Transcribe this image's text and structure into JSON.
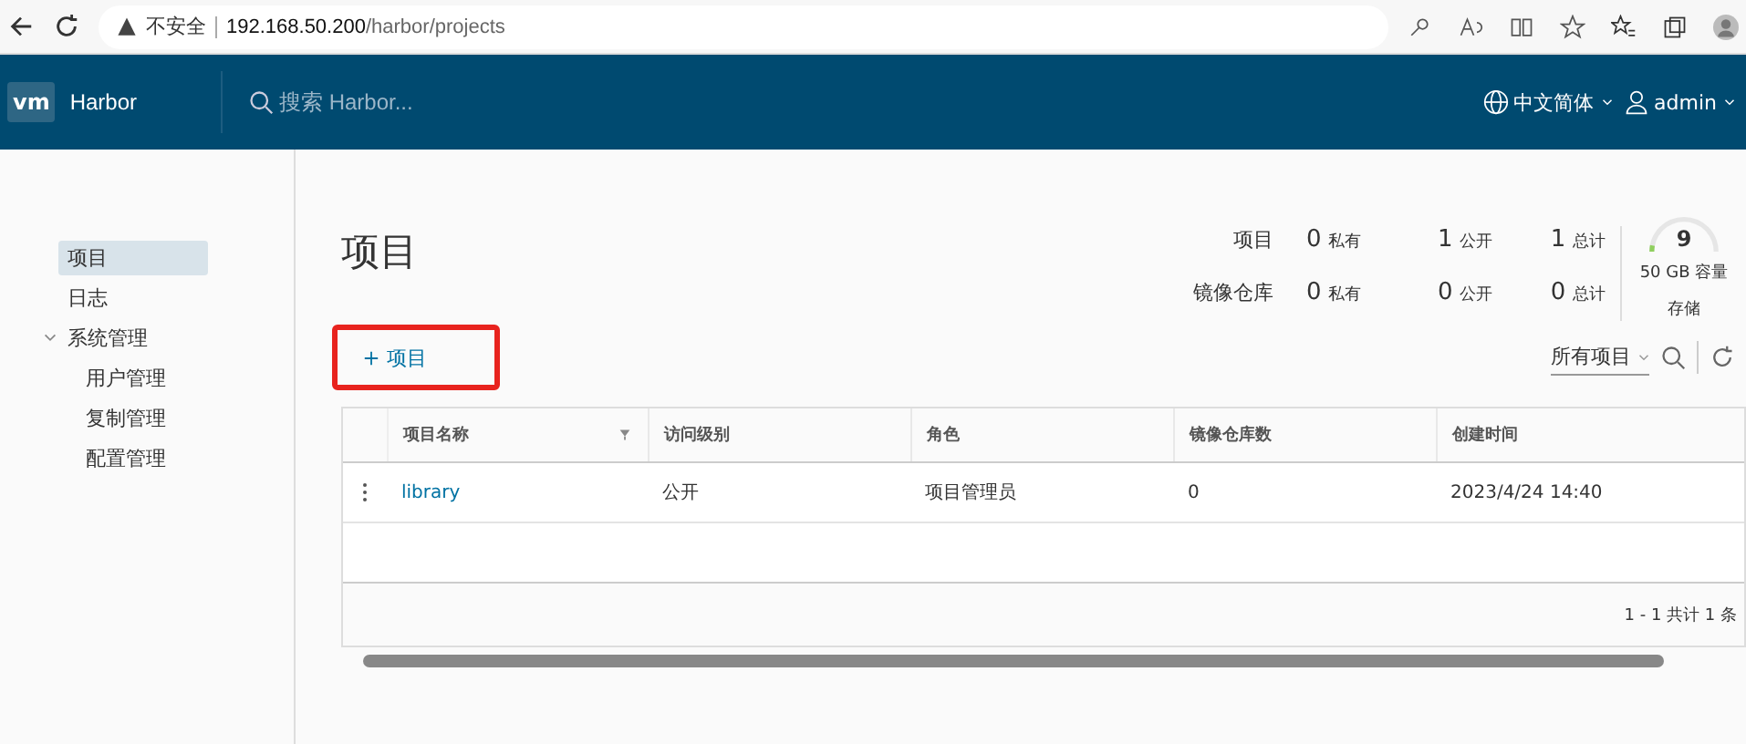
{
  "browser": {
    "security": "不安全",
    "url_host": "192.168.50.200",
    "url_path": "/harbor/projects"
  },
  "header": {
    "logo": "vm",
    "title": "Harbor",
    "search_placeholder": "搜索 Harbor...",
    "language": "中文简体",
    "user": "admin"
  },
  "sidebar": {
    "items": [
      {
        "label": "项目",
        "selected": true
      },
      {
        "label": "日志",
        "selected": false
      },
      {
        "label": "系统管理",
        "selected": false,
        "expanded": true,
        "children": [
          {
            "label": "用户管理",
            "selected": false
          },
          {
            "label": "复制管理",
            "selected": false
          },
          {
            "label": "配置管理",
            "selected": false
          }
        ]
      }
    ]
  },
  "page_title": "项目",
  "summary": {
    "rows": [
      {
        "label": "项目",
        "cells": [
          {
            "value": "0",
            "unit": "私有"
          },
          {
            "value": "1",
            "unit": "公开"
          },
          {
            "value": "1",
            "unit": "总计"
          }
        ]
      },
      {
        "label": "镜像仓库",
        "cells": [
          {
            "value": "0",
            "unit": "私有"
          },
          {
            "value": "0",
            "unit": "公开"
          },
          {
            "value": "0",
            "unit": "总计"
          }
        ]
      }
    ],
    "storage": {
      "value": "9",
      "capacity": "50 GB 容量",
      "label": "存储",
      "level": 0.06
    }
  },
  "new_button": {
    "label": "项目",
    "highlighted": true
  },
  "filter": {
    "label": "所有项目"
  },
  "table": {
    "columns": [
      "项目名称",
      "访问级别",
      "角色",
      "镜像仓库数",
      "创建时间"
    ],
    "rows": [
      {
        "cells": [
          "library",
          "公开",
          "项目管理员",
          "0",
          "2023/4/24 14:40"
        ]
      }
    ],
    "footer": "1 - 1 共计 1 条"
  }
}
